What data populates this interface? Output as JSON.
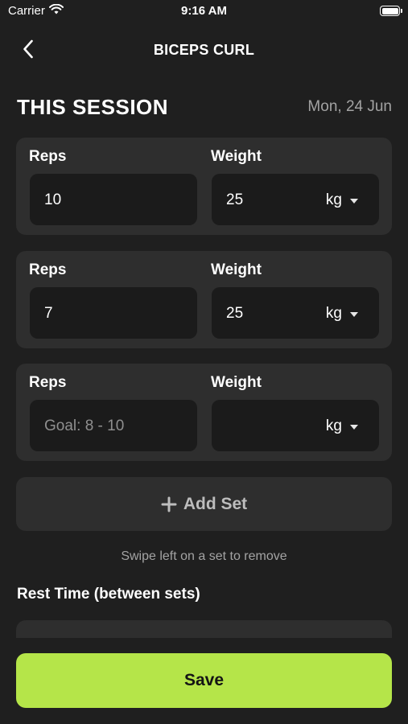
{
  "status_bar": {
    "carrier": "Carrier",
    "time": "9:16 AM"
  },
  "nav": {
    "title": "BICEPS CURL"
  },
  "session": {
    "title": "THIS SESSION",
    "date": "Mon, 24 Jun"
  },
  "sets": [
    {
      "reps_label": "Reps",
      "weight_label": "Weight",
      "reps_value": "10",
      "weight_value": "25",
      "unit": "kg"
    },
    {
      "reps_label": "Reps",
      "weight_label": "Weight",
      "reps_value": "7",
      "weight_value": "25",
      "unit": "kg"
    },
    {
      "reps_label": "Reps",
      "weight_label": "Weight",
      "reps_placeholder": "Goal: 8 - 10",
      "weight_value": "",
      "unit": "kg"
    }
  ],
  "add_set_label": "Add Set",
  "hint": "Swipe left on a set to remove",
  "rest_time_label": "Rest Time (between sets)",
  "save_label": "Save",
  "colors": {
    "background": "#1f1f1f",
    "card": "#2e2e2e",
    "field": "#1b1b1b",
    "accent": "#b5e549"
  }
}
